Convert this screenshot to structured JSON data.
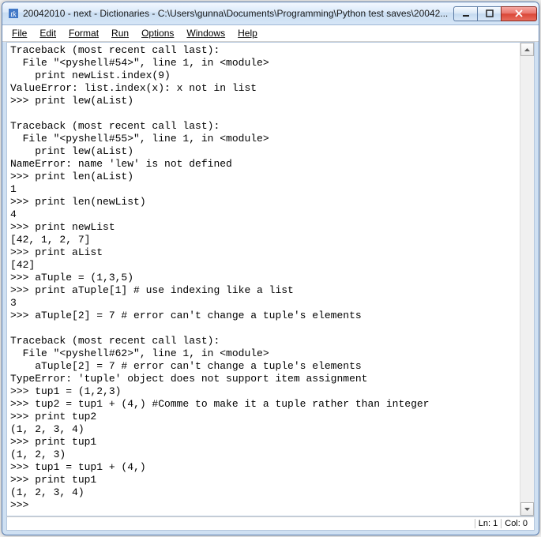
{
  "window": {
    "title": "20042010 - next - Dictionaries - C:\\Users\\gunna\\Documents\\Programming\\Python test saves\\20042..."
  },
  "menus": {
    "file": "File",
    "edit": "Edit",
    "format": "Format",
    "run": "Run",
    "options": "Options",
    "windows": "Windows",
    "help": "Help"
  },
  "code_lines": [
    "Traceback (most recent call last):",
    "  File \"<pyshell#54>\", line 1, in <module>",
    "    print newList.index(9)",
    "ValueError: list.index(x): x not in list",
    ">>> print lew(aList)",
    "",
    "Traceback (most recent call last):",
    "  File \"<pyshell#55>\", line 1, in <module>",
    "    print lew(aList)",
    "NameError: name 'lew' is not defined",
    ">>> print len(aList)",
    "1",
    ">>> print len(newList)",
    "4",
    ">>> print newList",
    "[42, 1, 2, 7]",
    ">>> print aList",
    "[42]",
    ">>> aTuple = (1,3,5)",
    ">>> print aTuple[1] # use indexing like a list",
    "3",
    ">>> aTuple[2] = 7 # error can't change a tuple's elements",
    "",
    "Traceback (most recent call last):",
    "  File \"<pyshell#62>\", line 1, in <module>",
    "    aTuple[2] = 7 # error can't change a tuple's elements",
    "TypeError: 'tuple' object does not support item assignment",
    ">>> tup1 = (1,2,3)",
    ">>> tup2 = tup1 + (4,) #Comme to make it a tuple rather than integer",
    ">>> print tup2",
    "(1, 2, 3, 4)",
    ">>> print tup1",
    "(1, 2, 3)",
    ">>> tup1 = tup1 + (4,)",
    ">>> print tup1",
    "(1, 2, 3, 4)",
    ">>> "
  ],
  "status": {
    "line": "Ln: 1",
    "col": "Col: 0"
  }
}
